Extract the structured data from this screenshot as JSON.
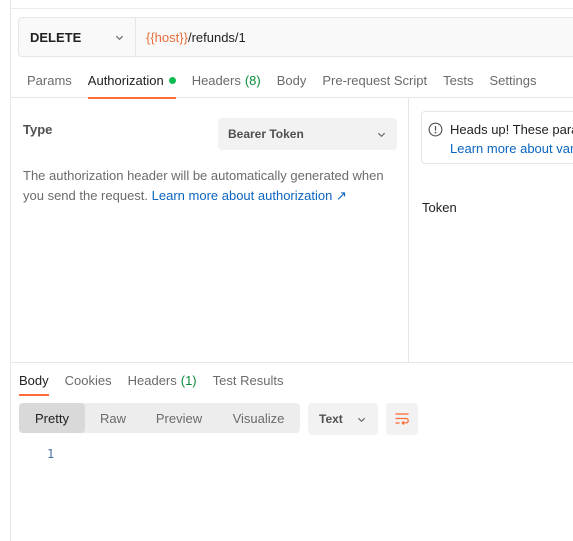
{
  "request": {
    "method": "DELETE",
    "url_var": "{{host}}",
    "url_path": "/refunds/1"
  },
  "request_tabs": [
    {
      "label": "Params"
    },
    {
      "label": "Authorization"
    },
    {
      "label": "Headers",
      "count": "(8)"
    },
    {
      "label": "Body"
    },
    {
      "label": "Pre-request Script"
    },
    {
      "label": "Tests"
    },
    {
      "label": "Settings"
    }
  ],
  "auth": {
    "type_label": "Type",
    "type_value": "Bearer Token",
    "description": "The authorization header will be automatically generated when you send the request.",
    "learn_more": "Learn more about authorization ↗",
    "heads_up_title": "Heads up! These parameters hold sensitive data.",
    "heads_up_link": "Learn more about variables",
    "token_label": "Token"
  },
  "response_tabs": [
    {
      "label": "Body"
    },
    {
      "label": "Cookies"
    },
    {
      "label": "Headers",
      "count": "(1)"
    },
    {
      "label": "Test Results"
    }
  ],
  "view_modes": [
    "Pretty",
    "Raw",
    "Preview",
    "Visualize"
  ],
  "format": "Text",
  "line_number": "1",
  "colors": {
    "accent": "#ff6c37",
    "variable": "#e8703a",
    "link": "#0b65c2",
    "success": "#0cbb52"
  }
}
